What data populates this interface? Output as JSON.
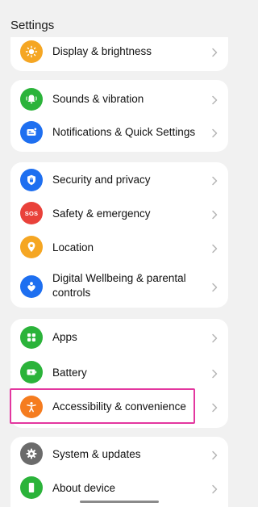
{
  "header": {
    "title": "Settings"
  },
  "items": {
    "display": {
      "label": "Display & brightness",
      "icon": "sun-icon",
      "color": "#f5a623"
    },
    "sounds": {
      "label": "Sounds & vibration",
      "icon": "bell-icon",
      "color": "#2bb33a"
    },
    "notifications": {
      "label": "Notifications & Quick Settings",
      "icon": "notification-icon",
      "color": "#1e6ff0"
    },
    "security": {
      "label": "Security and privacy",
      "icon": "shield-icon",
      "color": "#1e6ff0"
    },
    "safety": {
      "label": "Safety & emergency",
      "icon": "sos-icon",
      "badge": "SOS",
      "color": "#e9413a"
    },
    "location": {
      "label": "Location",
      "icon": "location-pin-icon",
      "color": "#f5a623"
    },
    "wellbeing": {
      "label": "Digital Wellbeing & parental controls",
      "icon": "heart-person-icon",
      "color": "#1e6ff0"
    },
    "apps": {
      "label": "Apps",
      "icon": "apps-grid-icon",
      "color": "#2bb33a"
    },
    "battery": {
      "label": "Battery",
      "icon": "battery-icon",
      "color": "#2bb33a"
    },
    "accessibility": {
      "label": "Accessibility & convenience",
      "icon": "accessibility-icon",
      "color": "#f57c1f"
    },
    "system": {
      "label": "System & updates",
      "icon": "gear-icon",
      "color": "#6b6b6b"
    },
    "about": {
      "label": "About device",
      "icon": "phone-icon",
      "color": "#2bb33a"
    }
  },
  "highlight_color": "#e3379f"
}
